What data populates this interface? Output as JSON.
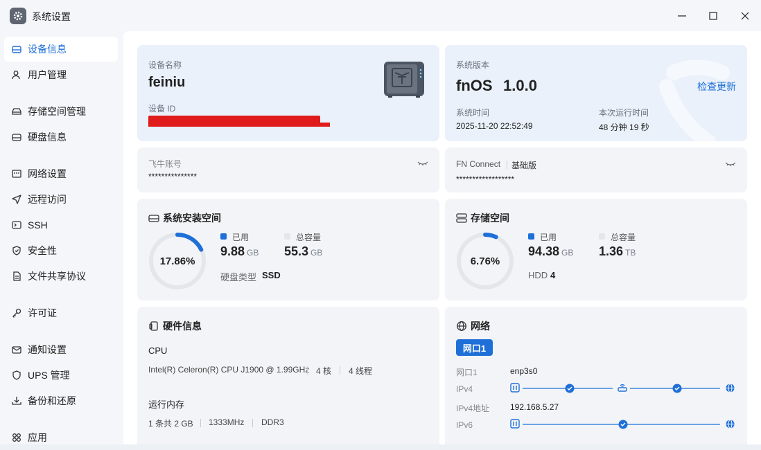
{
  "app": {
    "title": "系统设置"
  },
  "sidebar": {
    "items": [
      {
        "label": "设备信息",
        "icon": "device-info-icon",
        "active": true
      },
      {
        "label": "用户管理",
        "icon": "user-icon"
      },
      {
        "label": "存储空间管理",
        "icon": "storage-icon"
      },
      {
        "label": "硬盘信息",
        "icon": "disk-icon"
      },
      {
        "label": "网络设置",
        "icon": "network-icon"
      },
      {
        "label": "远程访问",
        "icon": "send-icon"
      },
      {
        "label": "SSH",
        "icon": "terminal-icon"
      },
      {
        "label": "安全性",
        "icon": "shield-icon"
      },
      {
        "label": "文件共享协议",
        "icon": "file-icon"
      },
      {
        "label": "许可证",
        "icon": "key-icon"
      },
      {
        "label": "通知设置",
        "icon": "mail-icon"
      },
      {
        "label": "UPS 管理",
        "icon": "ups-shield-icon"
      },
      {
        "label": "备份和还原",
        "icon": "backup-icon"
      },
      {
        "label": "应用",
        "icon": "apps-icon"
      }
    ]
  },
  "device": {
    "name_label": "设备名称",
    "name": "feiniu",
    "id_label": "设备 ID"
  },
  "system": {
    "version_label": "系统版本",
    "os_name": "fnOS",
    "version": "1.0.0",
    "check_update": "检查更新",
    "time_label": "系统时间",
    "time": "2025-11-20 22:52:49",
    "uptime_label": "本次运行时间",
    "uptime": "48 分钟 19 秒"
  },
  "account": {
    "label": "飞牛账号",
    "masked": "***************"
  },
  "fnconnect": {
    "label": "FN Connect",
    "tier": "基础版",
    "masked": "******************"
  },
  "system_space": {
    "title": "系统安装空间",
    "percent_text": "17.86%",
    "percent": 17.86,
    "used_label": "已用",
    "used_value": "9.88",
    "used_unit": "GB",
    "total_label": "总容量",
    "total_value": "55.3",
    "total_unit": "GB",
    "disk_type_label": "硬盘类型",
    "disk_type": "SSD"
  },
  "storage": {
    "title": "存储空间",
    "percent_text": "6.76%",
    "percent": 6.76,
    "used_label": "已用",
    "used_value": "94.38",
    "used_unit": "GB",
    "total_label": "总容量",
    "total_value": "1.36",
    "total_unit": "TB",
    "hdd_label": "HDD",
    "hdd_count": "4"
  },
  "hardware": {
    "title": "硬件信息",
    "cpu_label": "CPU",
    "cpu_model": "Intel(R) Celeron(R) CPU J1900 @ 1.99GHz",
    "cpu_cores": "4 核",
    "cpu_threads": "4 线程",
    "mem_label": "运行内存",
    "mem_count": "1 条共 2 GB",
    "mem_speed": "1333MHz",
    "mem_type": "DDR3"
  },
  "network": {
    "title": "网络",
    "tab": "网口1",
    "port_label": "网口1",
    "port_value": "enp3s0",
    "ipv4_label": "IPv4",
    "ipv4_addr_label": "IPv4地址",
    "ipv4_addr": "192.168.5.27",
    "ipv6_label": "IPv6"
  },
  "colors": {
    "accent": "#1f6fd8",
    "ring_track": "#e3e6ea",
    "redaction": "#e01b1b"
  }
}
